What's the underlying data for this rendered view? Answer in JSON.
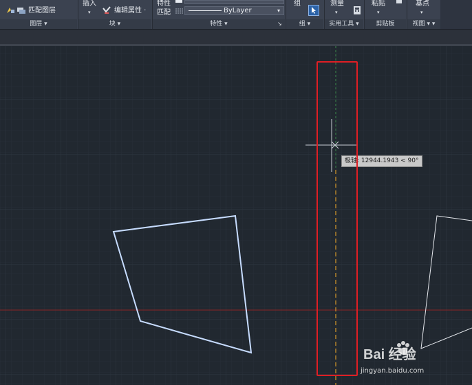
{
  "ribbon": {
    "layer_panel": {
      "title": "图层 ▾",
      "match_layer_label": "匹配图层"
    },
    "block_panel": {
      "title": "块 ▾",
      "insert_label": "插入",
      "edit_attributes_label": "编辑属性 ·"
    },
    "properties_panel": {
      "title": "特性 ▾",
      "match_properties_line1": "特性",
      "match_properties_line2": "匹配",
      "linetype_value": "ByLayer"
    },
    "groups_panel": {
      "title": "组 ▾",
      "group_label": "组"
    },
    "utilities_panel": {
      "title": "实用工具 ▾",
      "measure_label": "测量"
    },
    "clipboard_panel": {
      "title": "剪贴板",
      "paste_label": "粘贴"
    },
    "view_panel": {
      "title": "视图 ▾ ▾",
      "base_point_label": "基点"
    }
  },
  "drawing": {
    "polar_tooltip": "极轴: 12944.1943 < 90°",
    "colors": {
      "background": "#212830",
      "grid": "#2b333d",
      "x_axis": "#8a2426",
      "polar_track_upper": "#3a8a4a",
      "polar_track_lower": "#d69a2a",
      "shape_outline": "#c7dcff",
      "highlight": "#e01e24"
    }
  },
  "watermark": {
    "brand": "Bai 经验",
    "url": "jingyan.baidu.com"
  }
}
